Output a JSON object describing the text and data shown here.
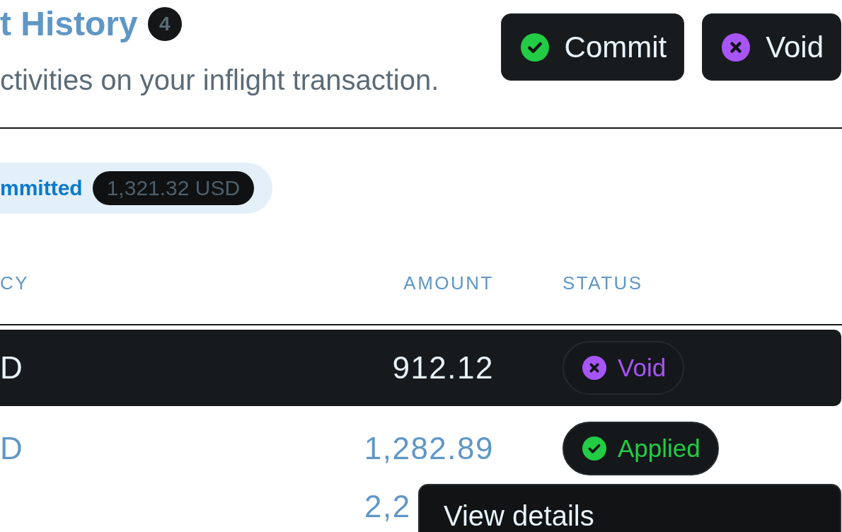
{
  "header": {
    "title": "t History",
    "count": "4",
    "subtitle": "ctivities on your inflight transaction."
  },
  "actions": [
    {
      "label": "Commit",
      "kind": "commit"
    },
    {
      "label": "Void",
      "kind": "void"
    }
  ],
  "summary": {
    "label": "mmitted",
    "amount": "1,321.32 USD"
  },
  "table": {
    "columns": [
      "CY",
      "AMOUNT",
      "STATUS"
    ],
    "rows": [
      {
        "kind": "row",
        "selected": true,
        "currency": "D",
        "amount": "912.12",
        "status": {
          "label": "Void",
          "kind": "void"
        }
      },
      {
        "kind": "row",
        "selected": false,
        "currency": "D",
        "amount": "1,282.89",
        "status": {
          "label": "Applied",
          "kind": "applied"
        }
      },
      {
        "kind": "covered",
        "selected": false,
        "amount": "2,2"
      }
    ]
  },
  "menu": {
    "items": [
      {
        "label": "View details"
      }
    ]
  }
}
